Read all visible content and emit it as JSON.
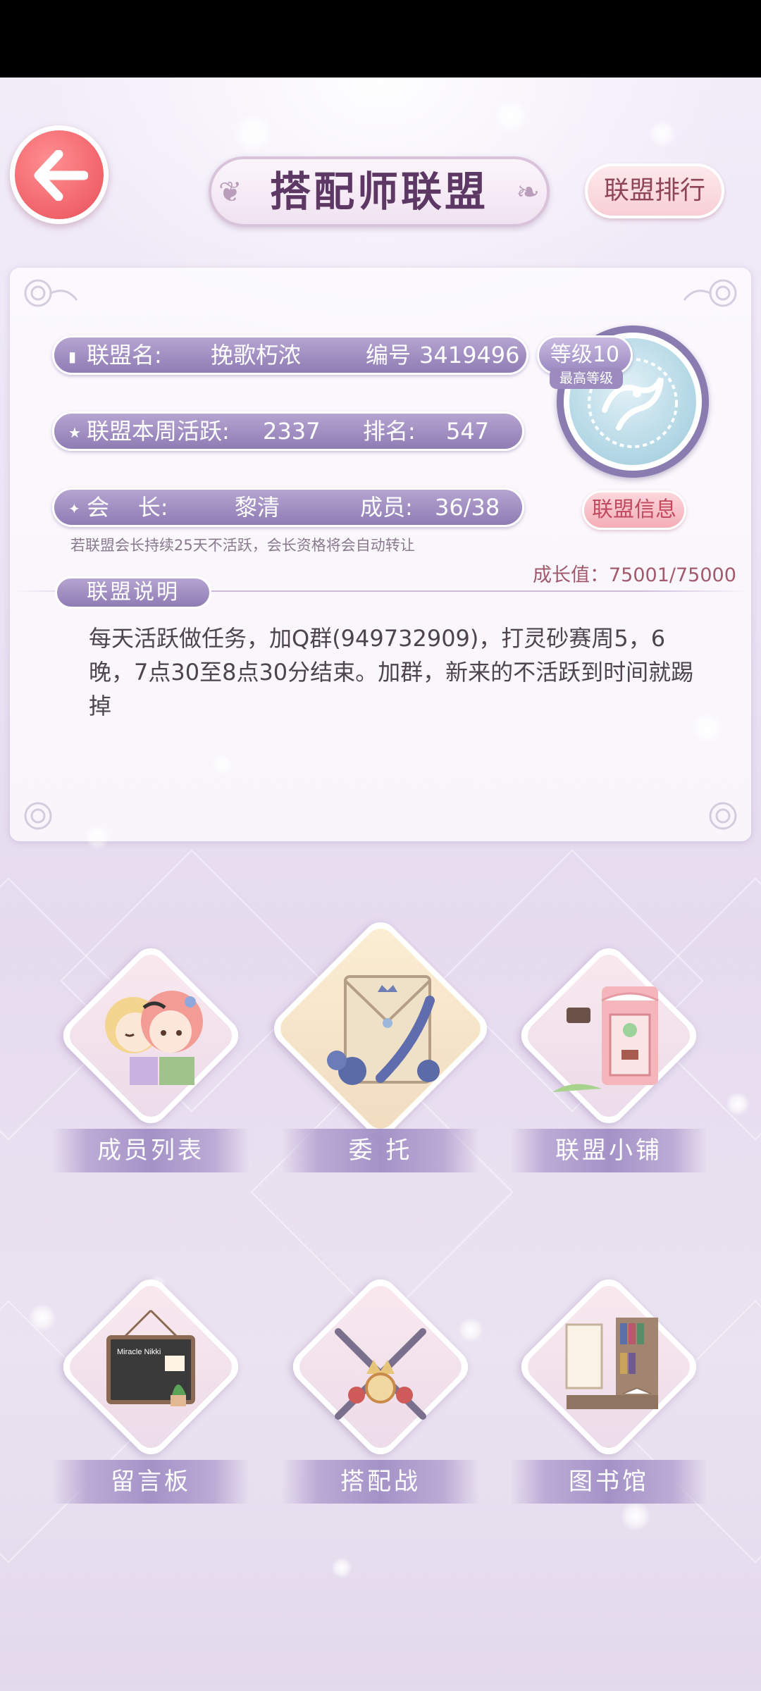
{
  "header": {
    "title": "搭配师联盟",
    "rank_button": "联盟排行"
  },
  "alliance": {
    "name_label": "联盟名:",
    "name": "挽歌朽浓",
    "id_label": "编号",
    "id": "3419496",
    "level": "等级10",
    "level_note": "最高等级",
    "weekly_activity_label": "联盟本周活跃:",
    "weekly_activity": "2337",
    "rank_label": "排名:",
    "rank": "547",
    "leader_label": "会    长:",
    "leader": "黎清",
    "members_label": "成员:",
    "members": "36/38",
    "info_button": "联盟信息",
    "notice": "若联盟会长持续25天不活跃，会长资格将会自动转让",
    "growth": "成长值：75001/75000"
  },
  "description": {
    "tag": "联盟说明",
    "text": "每天活跃做任务，加Q群(949732909)，打灵砂赛周5，6晚，7点30至8点30分结束。加群，新来的不活跃到时间就踢掉"
  },
  "features": [
    {
      "label": "成员列表"
    },
    {
      "label": "委  托"
    },
    {
      "label": "联盟小铺"
    },
    {
      "label": "留言板"
    },
    {
      "label": "搭配战"
    },
    {
      "label": "图书馆"
    }
  ],
  "board_text": "Miracle Nikki"
}
